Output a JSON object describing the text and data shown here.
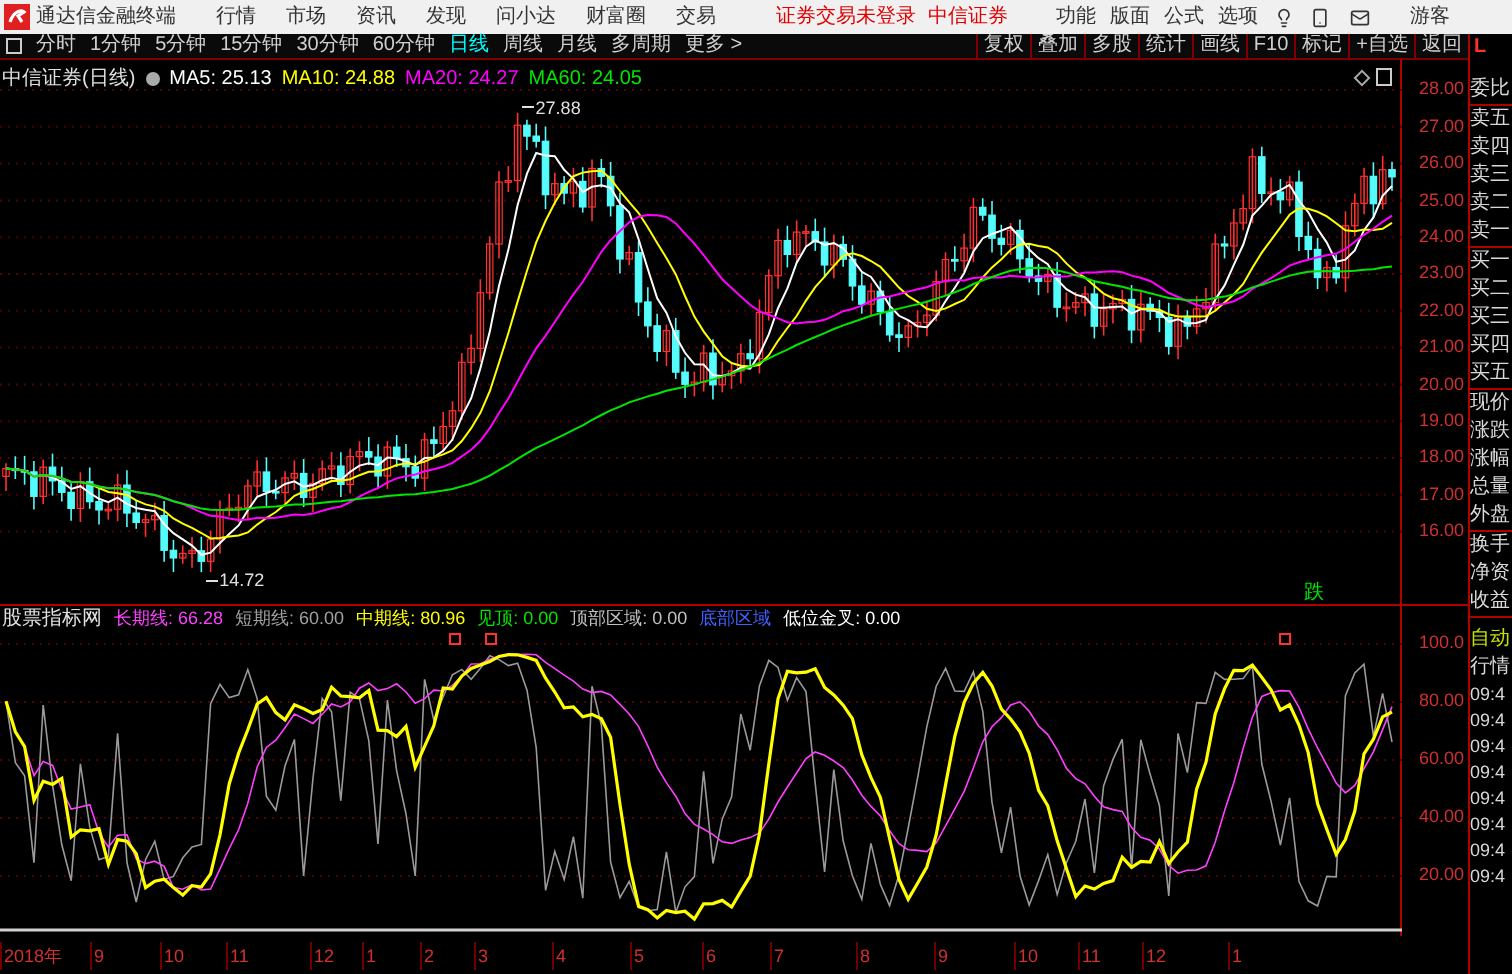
{
  "menu_bar": {
    "app_title": "通达信金融终端",
    "items": [
      "行情",
      "市场",
      "资讯",
      "发现",
      "问小达",
      "财富圈",
      "交易"
    ],
    "login_status": "证券交易未登录",
    "broker": "中信证券",
    "tools": [
      "功能",
      "版面",
      "公式",
      "选项"
    ],
    "user": "游客"
  },
  "period_tabs": [
    {
      "label": "分时",
      "selected": false
    },
    {
      "label": "1分钟",
      "selected": false
    },
    {
      "label": "5分钟",
      "selected": false
    },
    {
      "label": "15分钟",
      "selected": false
    },
    {
      "label": "30分钟",
      "selected": false
    },
    {
      "label": "60分钟",
      "selected": false
    },
    {
      "label": "日线",
      "selected": true
    },
    {
      "label": "周线",
      "selected": false
    },
    {
      "label": "月线",
      "selected": false
    },
    {
      "label": "多周期",
      "selected": false
    },
    {
      "label": "更多 >",
      "selected": false
    }
  ],
  "chart_tools": [
    "复权",
    "叠加",
    "多股",
    "统计",
    "画线",
    "F10",
    "标记",
    "+自选",
    "返回"
  ],
  "price_chart": {
    "title": "中信证券(日线)",
    "ma": [
      {
        "label": "MA5: 25.13",
        "color": "#ffffff"
      },
      {
        "label": "MA10: 24.88",
        "color": "#ffff00"
      },
      {
        "label": "MA20: 24.27",
        "color": "#ff00ff"
      },
      {
        "label": "MA60: 24.05",
        "color": "#00e600"
      }
    ],
    "high_label": "27.88",
    "low_label": "14.72",
    "signal": "跌",
    "yticks": [
      "28.00",
      "27.00",
      "26.00",
      "25.00",
      "24.00",
      "23.00",
      "22.00",
      "21.00",
      "20.00",
      "19.00",
      "18.00",
      "17.00",
      "16.00"
    ]
  },
  "indicator": {
    "name": "股票指标网",
    "values": [
      {
        "label": "长期线: 66.28",
        "color": "#ff40ff"
      },
      {
        "label": "短期线: 60.00",
        "color": "#a0a0a0"
      },
      {
        "label": "中期线: 80.96",
        "color": "#ffff00"
      },
      {
        "label": "见顶: 0.00",
        "color": "#00e600"
      },
      {
        "label": "顶部区域: 0.00",
        "color": "#c0c0c0"
      },
      {
        "label": "底部区域",
        "color": "#4060ff"
      },
      {
        "label": "低位金叉: 0.00",
        "color": "#ffffff"
      }
    ],
    "yticks": [
      "100.0",
      "80.00",
      "60.00",
      "40.00",
      "20.00"
    ]
  },
  "x_axis": [
    "2018年",
    "9",
    "10",
    "11",
    "12",
    "1",
    "2",
    "3",
    "4",
    "5",
    "6",
    "7",
    "8",
    "9",
    "10",
    "11",
    "12",
    "1"
  ],
  "side_panel": {
    "corner": "L",
    "quote_groups": [
      [
        "委比"
      ],
      [
        "卖五",
        "卖四",
        "卖三",
        "卖二",
        "卖一"
      ],
      [
        "买一",
        "买二",
        "买三",
        "买四",
        "买五"
      ],
      [
        "现价",
        "涨跌",
        "涨幅",
        "总量",
        "外盘"
      ],
      [
        "换手",
        "净资",
        "收益"
      ]
    ],
    "tabs": [
      {
        "label": "自动",
        "selected": true
      },
      {
        "label": "行情",
        "selected": false
      }
    ],
    "times": [
      "09:4",
      "09:4",
      "09:4",
      "09:4",
      "09:4",
      "09:4",
      "09:4",
      "09:4"
    ]
  }
}
